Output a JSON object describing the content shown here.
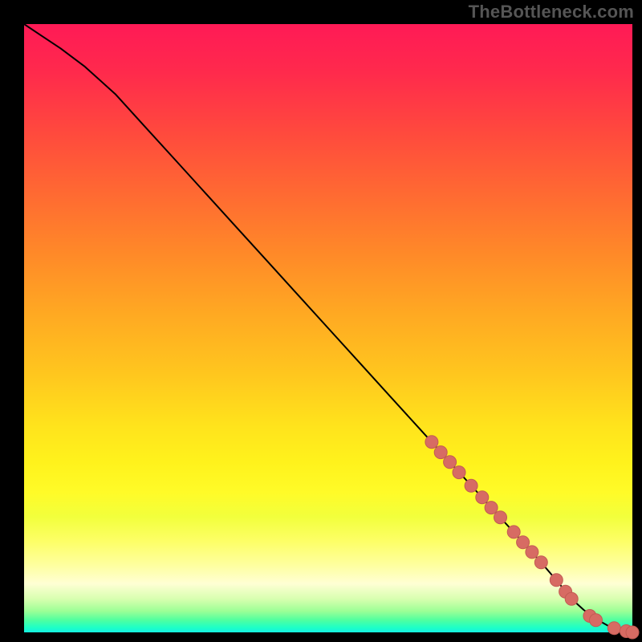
{
  "watermark": "TheBottleneck.com",
  "colors": {
    "curve_stroke": "#000000",
    "marker_fill": "#d76b63",
    "marker_stroke": "#c25b53"
  },
  "chart_data": {
    "type": "line",
    "title": "",
    "xlabel": "",
    "ylabel": "",
    "xlim": [
      0,
      100
    ],
    "ylim": [
      0,
      100
    ],
    "grid": false,
    "legend": false,
    "series": [
      {
        "name": "curve",
        "x": [
          0,
          3,
          6,
          10,
          15,
          20,
          25,
          30,
          35,
          40,
          45,
          50,
          55,
          60,
          65,
          70,
          75,
          80,
          85,
          88,
          90,
          92,
          94,
          96,
          98,
          100
        ],
        "y": [
          100,
          98,
          96,
          93,
          88.5,
          83,
          77.5,
          72,
          66.5,
          61,
          55.5,
          50,
          44.5,
          39,
          33.5,
          28,
          22.5,
          17,
          11.5,
          8,
          5.5,
          3.7,
          2.2,
          1.1,
          0.4,
          0
        ]
      }
    ],
    "markers": [
      {
        "x": 67.0,
        "y": 31.3
      },
      {
        "x": 68.5,
        "y": 29.6
      },
      {
        "x": 70.0,
        "y": 28.0
      },
      {
        "x": 71.5,
        "y": 26.3
      },
      {
        "x": 73.5,
        "y": 24.1
      },
      {
        "x": 75.3,
        "y": 22.2
      },
      {
        "x": 76.8,
        "y": 20.5
      },
      {
        "x": 78.3,
        "y": 18.9
      },
      {
        "x": 80.5,
        "y": 16.5
      },
      {
        "x": 82.0,
        "y": 14.8
      },
      {
        "x": 83.5,
        "y": 13.2
      },
      {
        "x": 85.0,
        "y": 11.5
      },
      {
        "x": 87.5,
        "y": 8.6
      },
      {
        "x": 89.0,
        "y": 6.7
      },
      {
        "x": 90.0,
        "y": 5.5
      },
      {
        "x": 93.0,
        "y": 2.7
      },
      {
        "x": 94.0,
        "y": 2.0
      },
      {
        "x": 97.0,
        "y": 0.7
      },
      {
        "x": 99.0,
        "y": 0.2
      },
      {
        "x": 100.0,
        "y": 0.0
      }
    ]
  }
}
